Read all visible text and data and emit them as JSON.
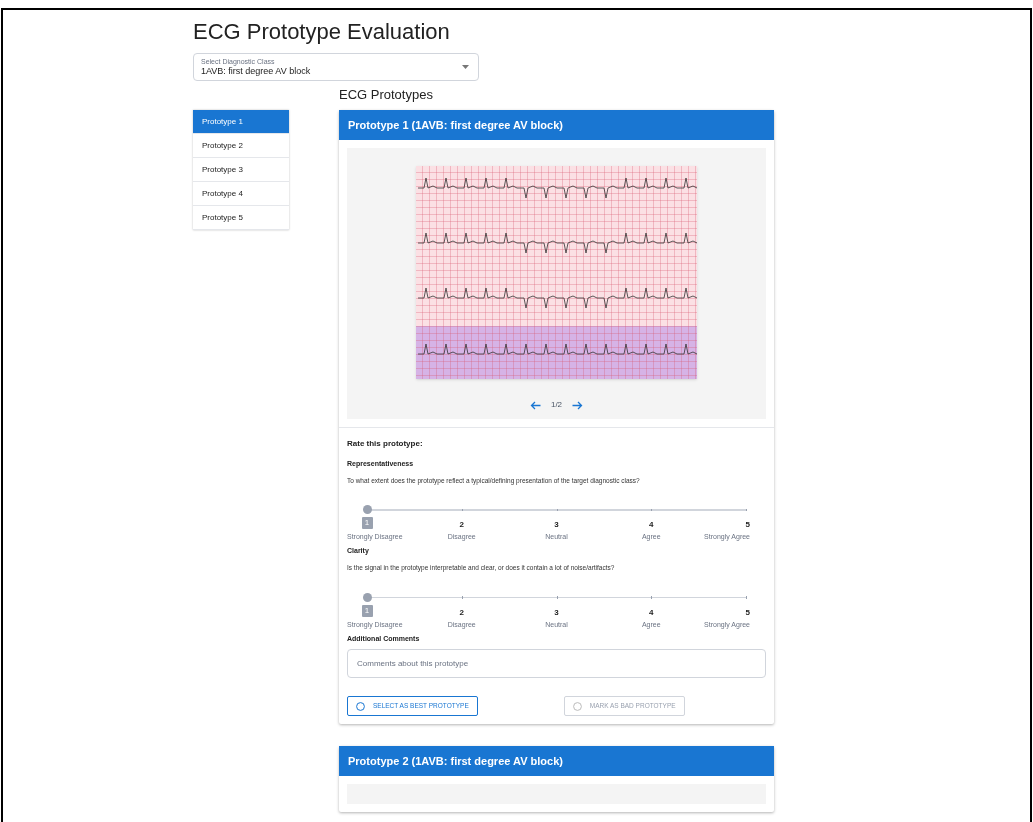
{
  "title": "ECG Prototype Evaluation",
  "class_select": {
    "label": "Select Diagnostic Class",
    "value": "1AVB: first degree AV block"
  },
  "sidebar": {
    "items": [
      {
        "label": "Prototype 1",
        "selected": true
      },
      {
        "label": "Prototype 2",
        "selected": false
      },
      {
        "label": "Prototype 3",
        "selected": false
      },
      {
        "label": "Prototype 4",
        "selected": false
      },
      {
        "label": "Prototype 5",
        "selected": false
      }
    ]
  },
  "section_title": "ECG Prototypes",
  "cards": [
    {
      "title": "Prototype 1 (1AVB: first degree AV block)",
      "pager": "1/2",
      "rate_title": "Rate this prototype:",
      "ratings": [
        {
          "title": "Representativeness",
          "question": "To what extent does the prototype reflect a typical/defining presentation of the target diagnostic class?",
          "level": 0,
          "value_label": "1",
          "marks": [
            {
              "label": "Strongly Disagree"
            },
            {
              "number": "2",
              "label": "Disagree"
            },
            {
              "number": "3",
              "label": "Neutral"
            },
            {
              "number": "4",
              "label": "Agree"
            },
            {
              "number": "5",
              "label": "Strongly Agree"
            }
          ]
        },
        {
          "title": "Clarity",
          "question": "Is the signal in the prototype interpretable and clear, or does it contain a lot of noise/artifacts?",
          "level": 0,
          "value_label": "1",
          "marks": [
            {
              "label": "Strongly Disagree"
            },
            {
              "number": "2",
              "label": "Disagree"
            },
            {
              "number": "3",
              "label": "Neutral"
            },
            {
              "number": "4",
              "label": "Agree"
            },
            {
              "number": "5",
              "label": "Strongly Agree"
            }
          ]
        }
      ],
      "comments": {
        "label": "Additional Comments",
        "placeholder": "Comments about this prototype"
      },
      "buttons": [
        {
          "label": "SELECT AS BEST PROTOTYPE",
          "selected": false,
          "disabled": false
        },
        {
          "label": "MARK AS BAD PROTOTYPE",
          "selected": false,
          "disabled": true
        }
      ]
    },
    {
      "title": "Prototype 2 (1AVB: first degree AV block)"
    }
  ]
}
